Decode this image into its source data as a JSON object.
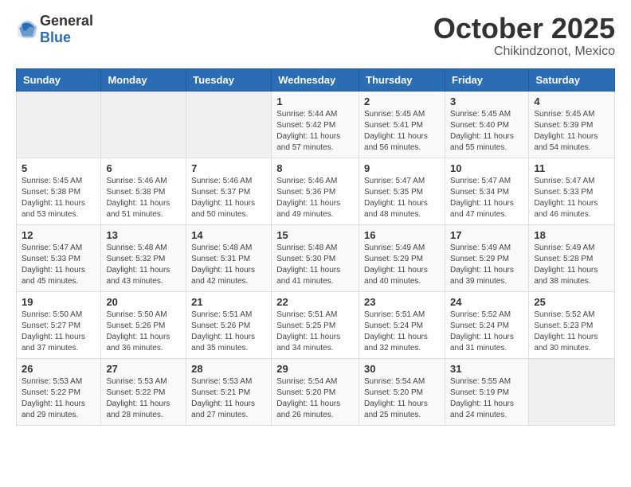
{
  "header": {
    "logo_general": "General",
    "logo_blue": "Blue",
    "month": "October 2025",
    "location": "Chikindzonot, Mexico"
  },
  "weekdays": [
    "Sunday",
    "Monday",
    "Tuesday",
    "Wednesday",
    "Thursday",
    "Friday",
    "Saturday"
  ],
  "weeks": [
    [
      {
        "day": "",
        "info": ""
      },
      {
        "day": "",
        "info": ""
      },
      {
        "day": "",
        "info": ""
      },
      {
        "day": "1",
        "info": "Sunrise: 5:44 AM\nSunset: 5:42 PM\nDaylight: 11 hours\nand 57 minutes."
      },
      {
        "day": "2",
        "info": "Sunrise: 5:45 AM\nSunset: 5:41 PM\nDaylight: 11 hours\nand 56 minutes."
      },
      {
        "day": "3",
        "info": "Sunrise: 5:45 AM\nSunset: 5:40 PM\nDaylight: 11 hours\nand 55 minutes."
      },
      {
        "day": "4",
        "info": "Sunrise: 5:45 AM\nSunset: 5:39 PM\nDaylight: 11 hours\nand 54 minutes."
      }
    ],
    [
      {
        "day": "5",
        "info": "Sunrise: 5:45 AM\nSunset: 5:38 PM\nDaylight: 11 hours\nand 53 minutes."
      },
      {
        "day": "6",
        "info": "Sunrise: 5:46 AM\nSunset: 5:38 PM\nDaylight: 11 hours\nand 51 minutes."
      },
      {
        "day": "7",
        "info": "Sunrise: 5:46 AM\nSunset: 5:37 PM\nDaylight: 11 hours\nand 50 minutes."
      },
      {
        "day": "8",
        "info": "Sunrise: 5:46 AM\nSunset: 5:36 PM\nDaylight: 11 hours\nand 49 minutes."
      },
      {
        "day": "9",
        "info": "Sunrise: 5:47 AM\nSunset: 5:35 PM\nDaylight: 11 hours\nand 48 minutes."
      },
      {
        "day": "10",
        "info": "Sunrise: 5:47 AM\nSunset: 5:34 PM\nDaylight: 11 hours\nand 47 minutes."
      },
      {
        "day": "11",
        "info": "Sunrise: 5:47 AM\nSunset: 5:33 PM\nDaylight: 11 hours\nand 46 minutes."
      }
    ],
    [
      {
        "day": "12",
        "info": "Sunrise: 5:47 AM\nSunset: 5:33 PM\nDaylight: 11 hours\nand 45 minutes."
      },
      {
        "day": "13",
        "info": "Sunrise: 5:48 AM\nSunset: 5:32 PM\nDaylight: 11 hours\nand 43 minutes."
      },
      {
        "day": "14",
        "info": "Sunrise: 5:48 AM\nSunset: 5:31 PM\nDaylight: 11 hours\nand 42 minutes."
      },
      {
        "day": "15",
        "info": "Sunrise: 5:48 AM\nSunset: 5:30 PM\nDaylight: 11 hours\nand 41 minutes."
      },
      {
        "day": "16",
        "info": "Sunrise: 5:49 AM\nSunset: 5:29 PM\nDaylight: 11 hours\nand 40 minutes."
      },
      {
        "day": "17",
        "info": "Sunrise: 5:49 AM\nSunset: 5:29 PM\nDaylight: 11 hours\nand 39 minutes."
      },
      {
        "day": "18",
        "info": "Sunrise: 5:49 AM\nSunset: 5:28 PM\nDaylight: 11 hours\nand 38 minutes."
      }
    ],
    [
      {
        "day": "19",
        "info": "Sunrise: 5:50 AM\nSunset: 5:27 PM\nDaylight: 11 hours\nand 37 minutes."
      },
      {
        "day": "20",
        "info": "Sunrise: 5:50 AM\nSunset: 5:26 PM\nDaylight: 11 hours\nand 36 minutes."
      },
      {
        "day": "21",
        "info": "Sunrise: 5:51 AM\nSunset: 5:26 PM\nDaylight: 11 hours\nand 35 minutes."
      },
      {
        "day": "22",
        "info": "Sunrise: 5:51 AM\nSunset: 5:25 PM\nDaylight: 11 hours\nand 34 minutes."
      },
      {
        "day": "23",
        "info": "Sunrise: 5:51 AM\nSunset: 5:24 PM\nDaylight: 11 hours\nand 32 minutes."
      },
      {
        "day": "24",
        "info": "Sunrise: 5:52 AM\nSunset: 5:24 PM\nDaylight: 11 hours\nand 31 minutes."
      },
      {
        "day": "25",
        "info": "Sunrise: 5:52 AM\nSunset: 5:23 PM\nDaylight: 11 hours\nand 30 minutes."
      }
    ],
    [
      {
        "day": "26",
        "info": "Sunrise: 5:53 AM\nSunset: 5:22 PM\nDaylight: 11 hours\nand 29 minutes."
      },
      {
        "day": "27",
        "info": "Sunrise: 5:53 AM\nSunset: 5:22 PM\nDaylight: 11 hours\nand 28 minutes."
      },
      {
        "day": "28",
        "info": "Sunrise: 5:53 AM\nSunset: 5:21 PM\nDaylight: 11 hours\nand 27 minutes."
      },
      {
        "day": "29",
        "info": "Sunrise: 5:54 AM\nSunset: 5:20 PM\nDaylight: 11 hours\nand 26 minutes."
      },
      {
        "day": "30",
        "info": "Sunrise: 5:54 AM\nSunset: 5:20 PM\nDaylight: 11 hours\nand 25 minutes."
      },
      {
        "day": "31",
        "info": "Sunrise: 5:55 AM\nSunset: 5:19 PM\nDaylight: 11 hours\nand 24 minutes."
      },
      {
        "day": "",
        "info": ""
      }
    ]
  ]
}
